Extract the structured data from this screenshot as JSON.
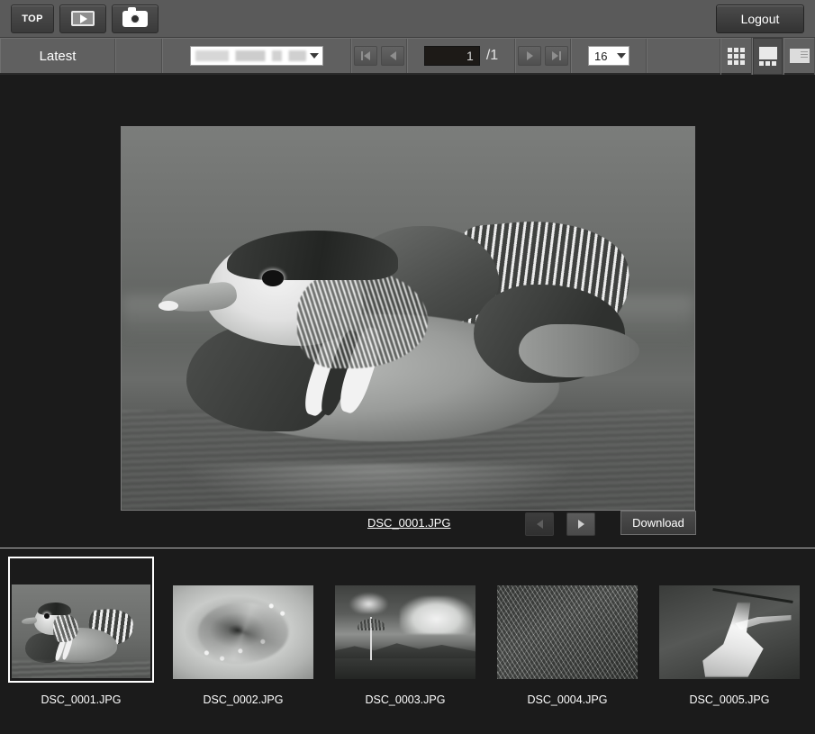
{
  "topbar": {
    "top_label": "TOP",
    "movie_icon": "movie-icon",
    "camera_icon": "camera-icon",
    "logout_label": "Logout"
  },
  "navbar": {
    "latest_label": "Latest",
    "folder_select": {
      "value": "",
      "redacted": true
    },
    "first_page_icon": "first-page-icon",
    "prev_page_icon": "prev-page-icon",
    "next_page_icon": "next-page-icon",
    "last_page_icon": "last-page-icon",
    "page_value": "1",
    "page_total": "/1",
    "per_page_value": "16",
    "views": {
      "grid_icon": "grid-view-icon",
      "filmstrip_icon": "filmstrip-view-icon",
      "single_icon": "single-view-icon",
      "active": "filmstrip"
    }
  },
  "viewer": {
    "image_alt": "mandarin-duck-photo",
    "filename": "DSC_0001.JPG",
    "prev_icon": "prev-image-icon",
    "next_icon": "next-image-icon",
    "download_label": "Download"
  },
  "thumbnails": [
    {
      "label": "DSC_0001.JPG",
      "art": "duck",
      "selected": true
    },
    {
      "label": "DSC_0002.JPG",
      "art": "rose",
      "selected": false
    },
    {
      "label": "DSC_0003.JPG",
      "art": "landscape",
      "selected": false
    },
    {
      "label": "DSC_0004.JPG",
      "art": "berries",
      "selected": false
    },
    {
      "label": "DSC_0005.JPG",
      "art": "waterfall",
      "selected": false
    }
  ],
  "colors": {
    "page_bg": "#1b1b1b",
    "topbar_bg": "#5a5a5a",
    "navbar_bg": "#606060",
    "text": "#ffffff",
    "input_bg": "#ffffff",
    "page_input_bg": "#1d1a17"
  }
}
